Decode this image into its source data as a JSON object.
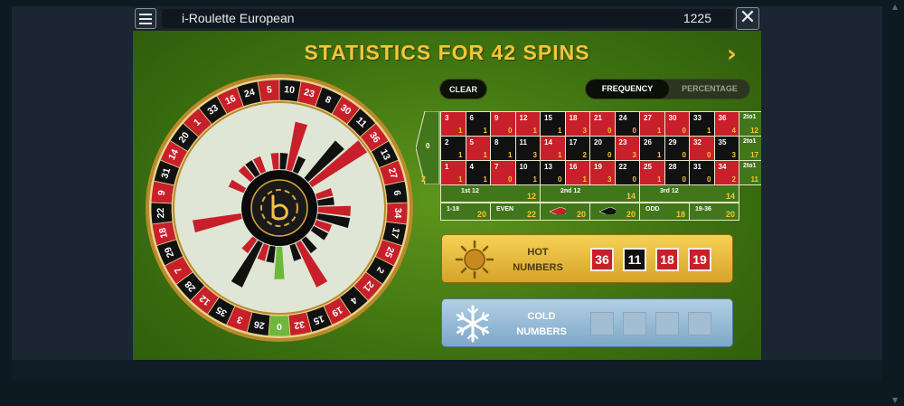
{
  "window": {
    "title": "i-Roulette European",
    "balance": "1225",
    "menu_icon": "hamburger-icon",
    "close_icon": "close-icon"
  },
  "heading": "STATISTICS FOR 42 SPINS",
  "controls": {
    "clear": "CLEAR",
    "frequency": "FREQUENCY",
    "percentage": "PERCENTAGE",
    "active_view": "FREQUENCY"
  },
  "wheel": {
    "order": [
      0,
      32,
      15,
      19,
      4,
      21,
      2,
      25,
      17,
      34,
      6,
      27,
      13,
      36,
      11,
      30,
      8,
      23,
      10,
      5,
      24,
      16,
      33,
      1,
      20,
      14,
      31,
      9,
      22,
      18,
      29,
      7,
      28,
      12,
      35,
      3,
      26
    ],
    "red_numbers": [
      1,
      3,
      5,
      7,
      9,
      12,
      14,
      16,
      18,
      19,
      21,
      23,
      25,
      27,
      30,
      32,
      34,
      36
    ],
    "colors": {
      "red": "#c8202a",
      "black": "#111111",
      "green": "#6db83a",
      "gold": "#d9a93a"
    },
    "logo_icon": "bet-logo-icon"
  },
  "board": {
    "zero": {
      "label": "0",
      "freq": "2"
    },
    "rows": [
      {
        "cells": [
          {
            "n": "3",
            "f": "1"
          },
          {
            "n": "6",
            "f": "1"
          },
          {
            "n": "9",
            "f": "0"
          },
          {
            "n": "12",
            "f": "1"
          },
          {
            "n": "15",
            "f": "1"
          },
          {
            "n": "18",
            "f": "3"
          },
          {
            "n": "21",
            "f": "0"
          },
          {
            "n": "24",
            "f": "0"
          },
          {
            "n": "27",
            "f": "1"
          },
          {
            "n": "30",
            "f": "0"
          },
          {
            "n": "33",
            "f": "1"
          },
          {
            "n": "36",
            "f": "4"
          }
        ],
        "col": {
          "label": "2to1",
          "freq": "12"
        }
      },
      {
        "cells": [
          {
            "n": "2",
            "f": "1"
          },
          {
            "n": "5",
            "f": "1"
          },
          {
            "n": "8",
            "f": "1"
          },
          {
            "n": "11",
            "f": "3"
          },
          {
            "n": "14",
            "f": "1"
          },
          {
            "n": "17",
            "f": "2"
          },
          {
            "n": "20",
            "f": "0"
          },
          {
            "n": "23",
            "f": "3"
          },
          {
            "n": "26",
            "f": "1"
          },
          {
            "n": "29",
            "f": "0"
          },
          {
            "n": "32",
            "f": "0"
          },
          {
            "n": "35",
            "f": "3"
          }
        ],
        "col": {
          "label": "2to1",
          "freq": "17"
        }
      },
      {
        "cells": [
          {
            "n": "1",
            "f": "1"
          },
          {
            "n": "4",
            "f": "1"
          },
          {
            "n": "7",
            "f": "0"
          },
          {
            "n": "10",
            "f": "1"
          },
          {
            "n": "13",
            "f": "0"
          },
          {
            "n": "16",
            "f": "1"
          },
          {
            "n": "19",
            "f": "3"
          },
          {
            "n": "22",
            "f": "0"
          },
          {
            "n": "25",
            "f": "1"
          },
          {
            "n": "28",
            "f": "0"
          },
          {
            "n": "31",
            "f": "0"
          },
          {
            "n": "34",
            "f": "2"
          }
        ],
        "col": {
          "label": "2to1",
          "freq": "11"
        }
      }
    ],
    "dozens": [
      {
        "label": "1st 12",
        "freq": "12"
      },
      {
        "label": "2nd 12",
        "freq": "14"
      },
      {
        "label": "3rd 12",
        "freq": "14"
      }
    ],
    "even_money": [
      {
        "label": "1-18",
        "freq": "20"
      },
      {
        "label": "EVEN",
        "freq": "22"
      },
      {
        "label": "",
        "freq": "20",
        "kind": "red-diamond-icon"
      },
      {
        "label": "",
        "freq": "20",
        "kind": "black-diamond-icon"
      },
      {
        "label": "ODD",
        "freq": "18"
      },
      {
        "label": "19-36",
        "freq": "20"
      }
    ]
  },
  "hot": {
    "label_line1": "HOT",
    "label_line2": "NUMBERS",
    "icon": "sun-icon",
    "numbers": [
      {
        "n": "36",
        "color": "#c8202a"
      },
      {
        "n": "11",
        "color": "#111111"
      },
      {
        "n": "18",
        "color": "#c8202a"
      },
      {
        "n": "19",
        "color": "#c8202a"
      }
    ]
  },
  "cold": {
    "label_line1": "COLD",
    "label_line2": "NUMBERS",
    "icon": "snowflake-icon",
    "slots": 4
  }
}
